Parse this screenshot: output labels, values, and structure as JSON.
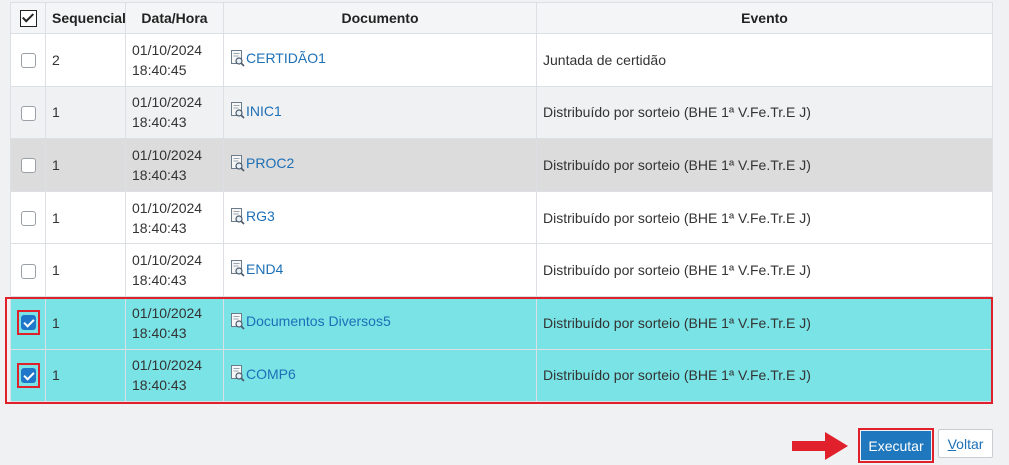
{
  "table": {
    "headers": {
      "select_all_checked": true,
      "sequencial": "Sequencial",
      "data_hora": "Data/Hora",
      "documento": "Documento",
      "evento": "Evento"
    },
    "rows": [
      {
        "checked": false,
        "seq": "2",
        "date": "01/10/2024",
        "time": "18:40:45",
        "doc": "CERTIDÃO1",
        "event": "Juntada de certidão"
      },
      {
        "checked": false,
        "seq": "1",
        "date": "01/10/2024",
        "time": "18:40:43",
        "doc": "INIC1",
        "event": "Distribuído por sorteio (BHE 1ª V.Fe.Tr.E J)"
      },
      {
        "checked": false,
        "seq": "1",
        "date": "01/10/2024",
        "time": "18:40:43",
        "doc": "PROC2",
        "event": "Distribuído por sorteio (BHE 1ª V.Fe.Tr.E J)"
      },
      {
        "checked": false,
        "seq": "1",
        "date": "01/10/2024",
        "time": "18:40:43",
        "doc": "RG3",
        "event": "Distribuído por sorteio (BHE 1ª V.Fe.Tr.E J)"
      },
      {
        "checked": false,
        "seq": "1",
        "date": "01/10/2024",
        "time": "18:40:43",
        "doc": "END4",
        "event": "Distribuído por sorteio (BHE 1ª V.Fe.Tr.E J)"
      },
      {
        "checked": true,
        "seq": "1",
        "date": "01/10/2024",
        "time": "18:40:43",
        "doc": "Documentos Diversos5",
        "event": "Distribuído por sorteio (BHE 1ª V.Fe.Tr.E J)"
      },
      {
        "checked": true,
        "seq": "1",
        "date": "01/10/2024",
        "time": "18:40:43",
        "doc": "COMP6",
        "event": "Distribuído por sorteio (BHE 1ª V.Fe.Tr.E J)"
      }
    ]
  },
  "actions": {
    "executar_label": "Executar",
    "voltar_first": "V",
    "voltar_rest": "oltar"
  },
  "colors": {
    "selected_row": "#79e3e6",
    "highlight_red": "#e0202b",
    "primary_button": "#1f78be",
    "link": "#1d6fb6"
  },
  "icons": {
    "document": "document-search-icon",
    "arrow": "right-arrow-icon"
  }
}
